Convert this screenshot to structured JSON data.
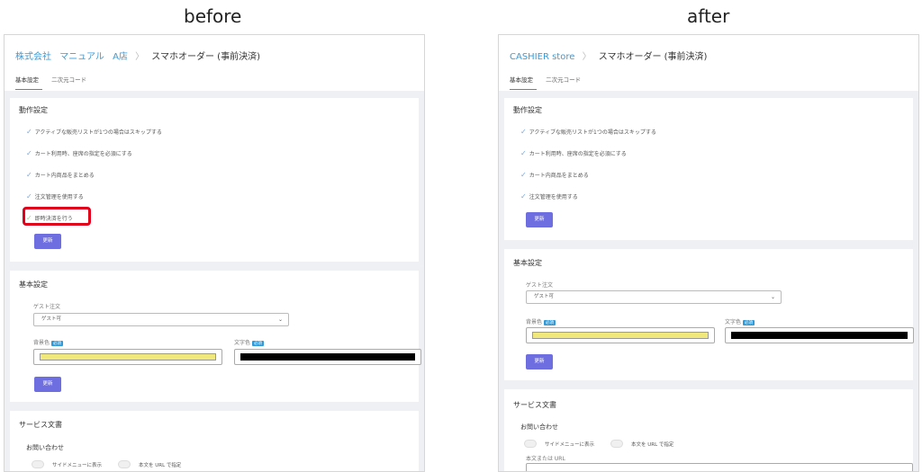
{
  "captions": {
    "before": "before",
    "after": "after"
  },
  "before": {
    "breadcrumb": {
      "company": "株式会社",
      "manual": "マニュアル",
      "store": "A店",
      "current": "スマホオーダー (事前決済)"
    },
    "tabs": [
      "基本設定",
      "二次元コード"
    ],
    "behavior": {
      "title": "動作設定",
      "options": [
        "アクティブな販売リストが1つの場合はスキップする",
        "カート利用時、座席の指定を必須にする",
        "カート内商品をまとめる",
        "注文管理を使用する",
        "即時決済を行う"
      ],
      "update_label": "更新"
    },
    "basic": {
      "title": "基本設定",
      "guest_label": "ゲスト注文",
      "guest_value": "ゲスト可",
      "bg_label": "背景色",
      "text_label": "文字色",
      "required": "必須",
      "update_label": "更新"
    },
    "service": {
      "title": "サービス文書",
      "inquiry": "お問い合わせ",
      "sidebar_toggle": "サイドメニューに表示",
      "url_toggle": "本文を URL で指定"
    },
    "colors": {
      "bg_swatch": "#f0e87a",
      "text_swatch": "#000000"
    }
  },
  "after": {
    "breadcrumb": {
      "store": "CASHIER store",
      "current": "スマホオーダー (事前決済)"
    },
    "tabs": [
      "基本設定",
      "二次元コード"
    ],
    "behavior": {
      "title": "動作設定",
      "options": [
        "アクティブな販売リストが1つの場合はスキップする",
        "カート利用時、座席の指定を必須にする",
        "カート内商品をまとめる",
        "注文管理を使用する"
      ],
      "update_label": "更新"
    },
    "basic": {
      "title": "基本設定",
      "guest_label": "ゲスト注文",
      "guest_value": "ゲスト可",
      "bg_label": "背景色",
      "text_label": "文字色",
      "required": "必須",
      "update_label": "更新"
    },
    "service": {
      "title": "サービス文書",
      "inquiry": "お問い合わせ",
      "sidebar_toggle": "サイドメニューに表示",
      "url_toggle": "本文を URL で指定",
      "url_label": "本文または URL"
    },
    "colors": {
      "bg_swatch": "#f0e87a",
      "text_swatch": "#000000"
    }
  }
}
